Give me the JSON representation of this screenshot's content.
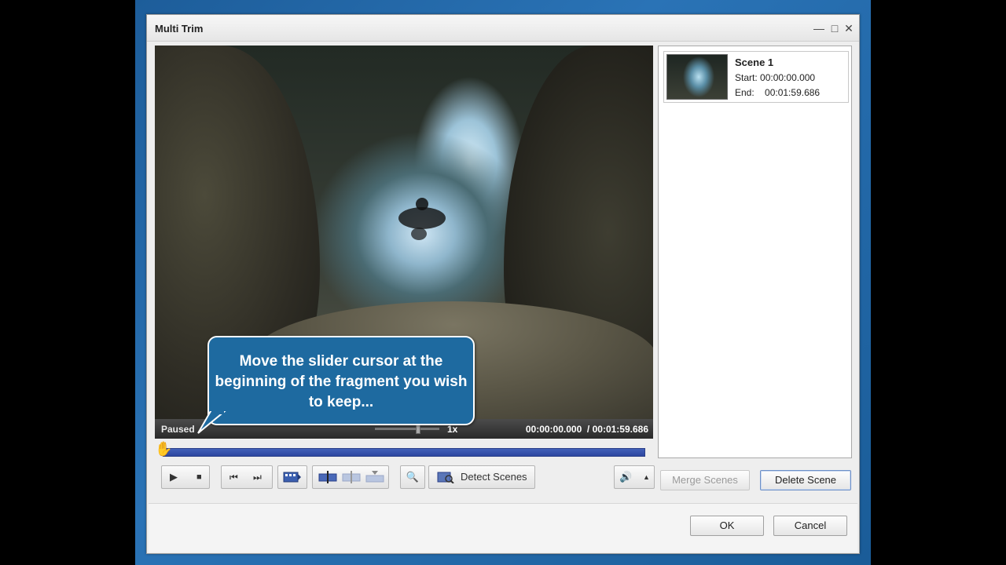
{
  "window": {
    "title": "Multi Trim",
    "controls": {
      "minimize": "—",
      "maximize": "□",
      "close": "✕"
    }
  },
  "player": {
    "status": "Paused",
    "speed": "1x",
    "time_current": "00:00:00.000",
    "time_separator": "/",
    "time_total": "00:01:59.686",
    "callout": "Move the slider cursor at the beginning of the fragment you wish to keep...",
    "timeline_progress": 0.0
  },
  "toolbar": {
    "play_icon": "▶",
    "stop_icon": "■",
    "prev_icon": "⏮",
    "next_icon": "⏭",
    "detect_scenes_label": "Detect Scenes",
    "volume_icon": "🔊",
    "volume_arrow": "▲",
    "zoom_icon": "🔍"
  },
  "scenes": [
    {
      "name": "Scene 1",
      "start_label": "Start:",
      "start": "00:00:00.000",
      "end_label": "End:",
      "end": "00:01:59.686"
    }
  ],
  "scene_buttons": {
    "merge": "Merge Scenes",
    "delete": "Delete Scene"
  },
  "dialog_buttons": {
    "ok": "OK",
    "cancel": "Cancel"
  },
  "colors": {
    "callout": "#1e6aa0",
    "timeline": "#3652b0",
    "desktop": "#2a73b6"
  }
}
